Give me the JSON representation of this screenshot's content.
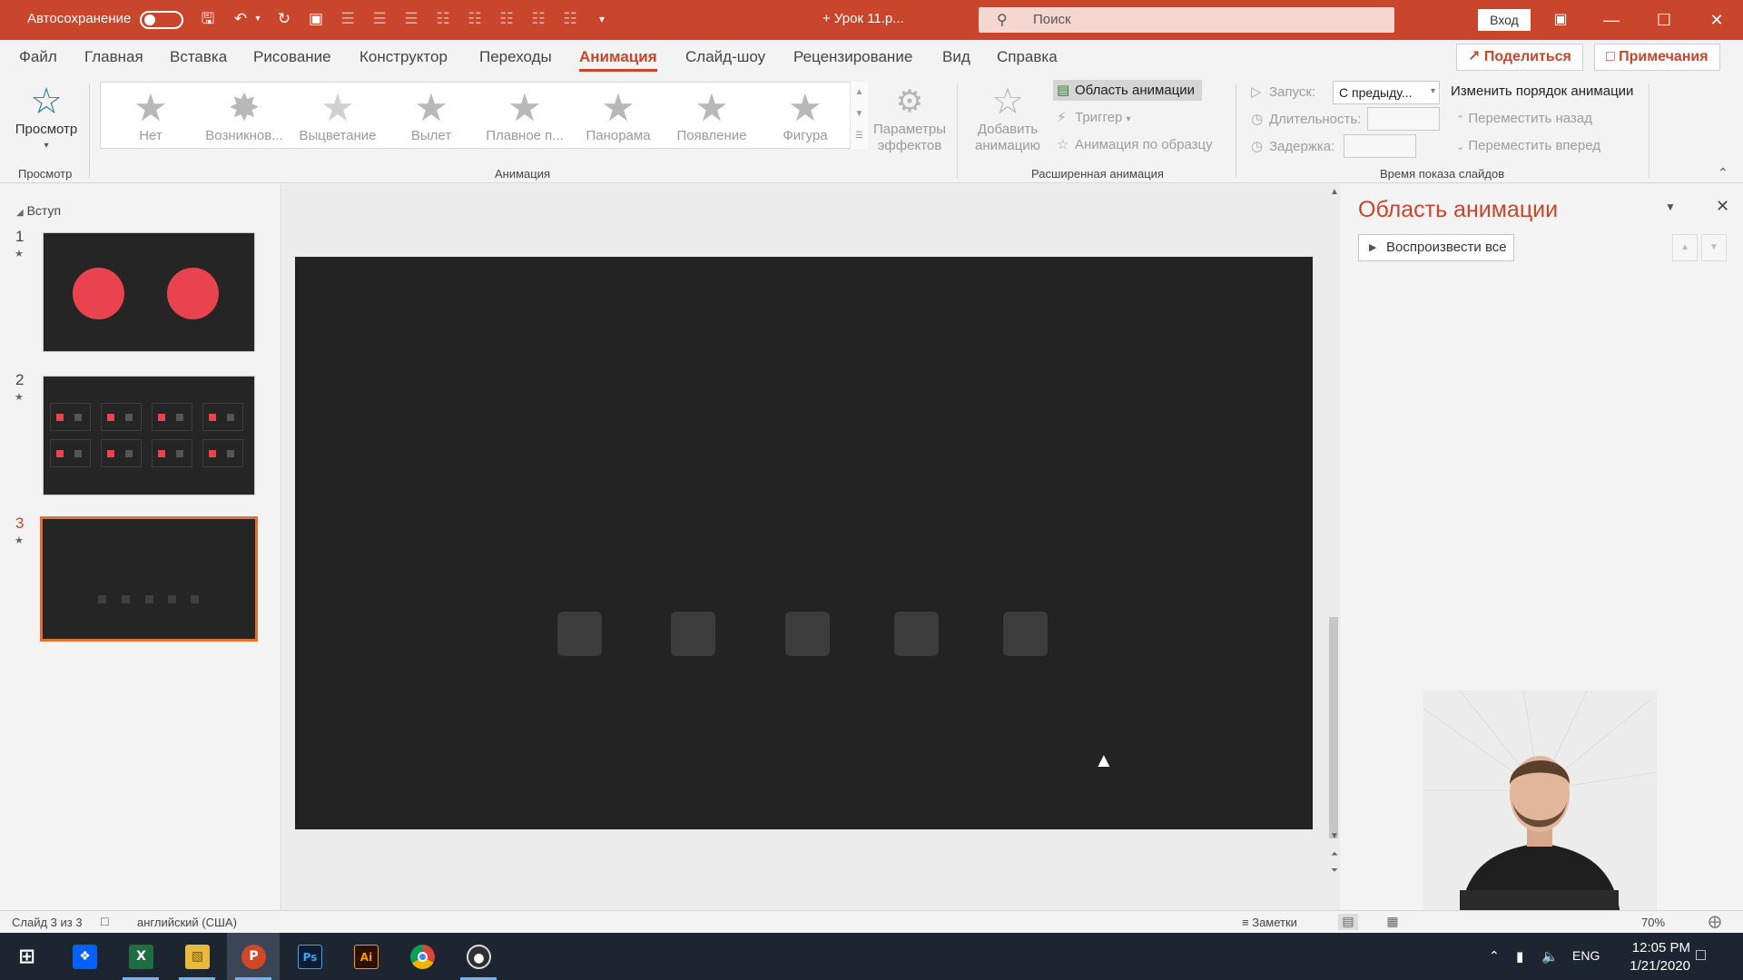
{
  "titlebar": {
    "autosave_label": "Автосохранение",
    "doc_title": "+ Урок 11.p...",
    "search_placeholder": "Поиск",
    "login_label": "Вход"
  },
  "menu": {
    "tabs": [
      "Файл",
      "Главная",
      "Вставка",
      "Рисование",
      "Конструктор",
      "Переходы",
      "Анимация",
      "Слайд-шоу",
      "Рецензирование",
      "Вид",
      "Справка"
    ],
    "active_tab": "Анимация",
    "share_label": "Поделиться",
    "comments_label": "Примечания"
  },
  "ribbon": {
    "preview": {
      "label": "Просмотр",
      "group": "Просмотр"
    },
    "animations": {
      "group": "Анимация",
      "items": [
        "Нет",
        "Возникнов...",
        "Выцветание",
        "Вылет",
        "Плавное п...",
        "Панорама",
        "Появление",
        "Фигура"
      ],
      "effect_options_line1": "Параметры",
      "effect_options_line2": "эффектов"
    },
    "advanced": {
      "group": "Расширенная анимация",
      "add_line1": "Добавить",
      "add_line2": "анимацию",
      "pane_label": "Область анимации",
      "trigger_label": "Триггер",
      "painter_label": "Анимация по образцу"
    },
    "timing": {
      "group": "Время показа слайдов",
      "start_label": "Запуск:",
      "start_value": "С предыду...",
      "duration_label": "Длительность:",
      "delay_label": "Задержка:",
      "reorder_label": "Изменить порядок анимации",
      "move_back_label": "Переместить назад",
      "move_forward_label": "Переместить вперед"
    }
  },
  "slides_panel": {
    "section_name": "Вступ",
    "slides": [
      {
        "number": "1",
        "has_animation_mark": "★"
      },
      {
        "number": "2",
        "has_animation_mark": "★"
      },
      {
        "number": "3",
        "has_animation_mark": "★"
      }
    ],
    "selected_slide": 3
  },
  "animation_pane": {
    "title": "Область анимации",
    "play_all_label": "Воспроизвести все"
  },
  "statusbar": {
    "slide_info": "Слайд 3 из 3",
    "language": "английский (США)",
    "notes_label": "Заметки",
    "zoom": "70%"
  },
  "taskbar": {
    "time": "12:05 PM",
    "date": "1/21/2020",
    "lang": "ENG",
    "apps": [
      "windows-start",
      "dropbox",
      "excel",
      "file-explorer",
      "powerpoint",
      "photoshop",
      "illustrator",
      "chrome",
      "obs"
    ]
  },
  "colors": {
    "accent": "#c9462c",
    "slide_bg": "#232323",
    "circle": "#e8434f",
    "selection": "#e2702f"
  }
}
